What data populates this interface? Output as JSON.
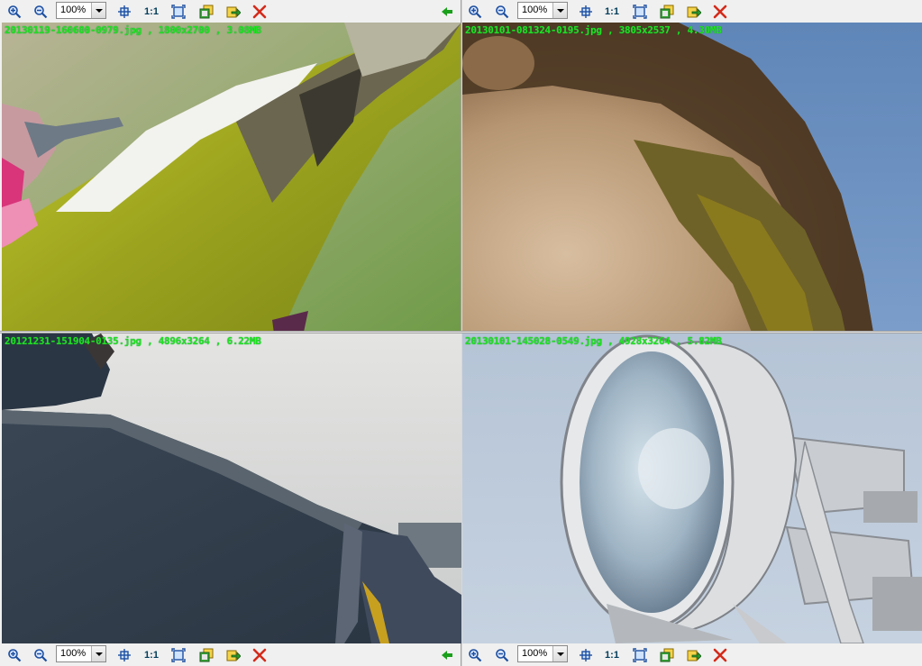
{
  "toolbars": {
    "zoom_value": "100%",
    "one_to_one_label": "1:1"
  },
  "panes": [
    {
      "file_info": "20130119-160600-0979.jpg , 1800x2700 , 3.08MB",
      "subject": "bird-wing"
    },
    {
      "file_info": "20130101-081324-0195.jpg , 3805x2537 , 4.30MB",
      "subject": "bird-breast"
    },
    {
      "file_info": "20121231-151904-0135.jpg , 4896x3264 , 6.22MB",
      "subject": "uniform-shoulder"
    },
    {
      "file_info": "20130101-145028-0549.jpg , 4928x3264 , 5.82MB",
      "subject": "floodlight"
    }
  ],
  "colors": {
    "file_info_text": "#22e022",
    "close_icon": "#d42a1a",
    "back_arrow": "#1aa01a",
    "zoom_icon": "#1d4fa0"
  }
}
